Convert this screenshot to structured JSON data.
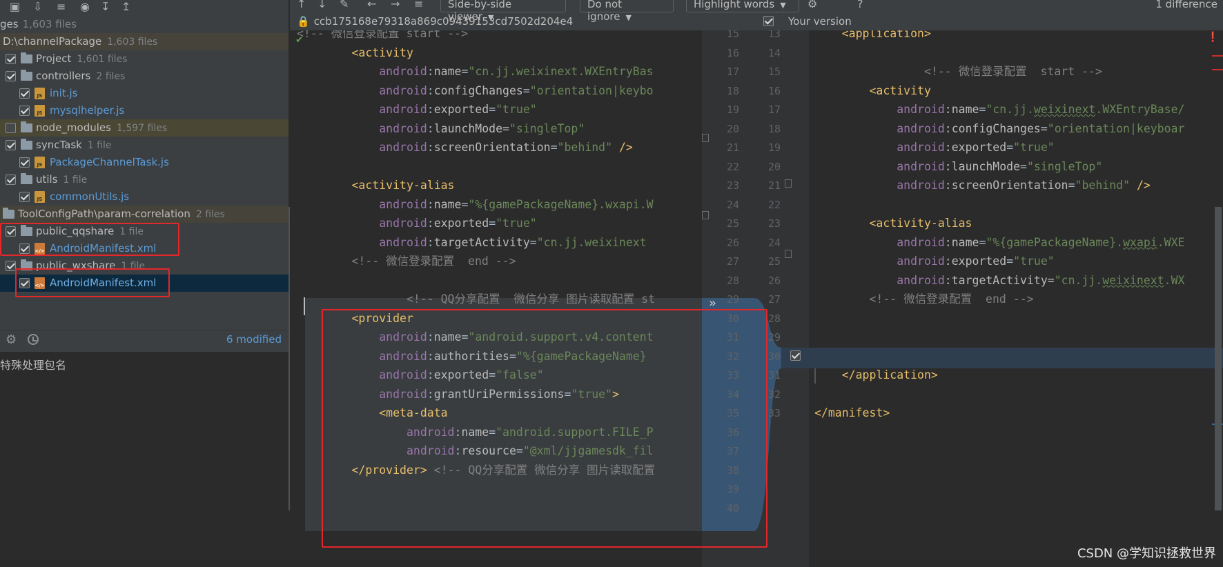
{
  "left_panel": {
    "header": {
      "label": "ges",
      "count": "1,603 files"
    },
    "tree": [
      {
        "label": "D:\\channelPackage",
        "count": "1,603 files",
        "kind": "group-root"
      },
      {
        "label": "Project",
        "count": "1,601 files",
        "kind": "folder"
      },
      {
        "label": "controllers",
        "count": "2 files",
        "kind": "folder"
      },
      {
        "label": "init.js",
        "count": "",
        "kind": "js"
      },
      {
        "label": "mysqlhelper.js",
        "count": "",
        "kind": "js"
      },
      {
        "label": "node_modules",
        "count": "1,597 files",
        "kind": "folder"
      },
      {
        "label": "syncTask",
        "count": "1 file",
        "kind": "folder"
      },
      {
        "label": "PackageChannelTask.js",
        "count": "",
        "kind": "js"
      },
      {
        "label": "utils",
        "count": "1 file",
        "kind": "folder"
      },
      {
        "label": "commonUtils.js",
        "count": "",
        "kind": "js"
      },
      {
        "label": "ToolConfigPath\\param-correlation",
        "count": "2 files",
        "kind": "group-root"
      },
      {
        "label": "public_qqshare",
        "count": "1 file",
        "kind": "folder"
      },
      {
        "label": "AndroidManifest.xml",
        "count": "",
        "kind": "xml"
      },
      {
        "label": "public_wxshare",
        "count": "1 file",
        "kind": "folder"
      },
      {
        "label": "AndroidManifest.xml",
        "count": "",
        "kind": "xml"
      }
    ],
    "status": {
      "modified": "6 modified"
    },
    "commit_message": "特殊处理包名"
  },
  "toolbar": {
    "viewer_mode": "Side-by-side viewer",
    "ignore_mode": "Do not ignore",
    "highlight_mode": "Highlight words",
    "help": "?",
    "diff_count": "1 difference",
    "left_revision": "ccb175168e79318a869c09439153cd7502d204e4",
    "right_label": "Your version"
  },
  "left_editor": {
    "lines": [
      {
        "n": "15",
        "html": "<span class='cmt'>&lt;!-- 微信登录配置 start --&gt;</span>"
      },
      {
        "n": "16",
        "html": "        <span class='tag'>&lt;activity</span>"
      },
      {
        "n": "17",
        "html": "            <span class='attr'>android</span><span class='plain'>:</span><span class='ns'>name</span><span class='plain'>=</span><span class='val'>\"cn.jj.weixinext.WXEntryBas</span>"
      },
      {
        "n": "18",
        "html": "            <span class='attr'>android</span><span class='plain'>:</span><span class='ns'>configChanges</span><span class='plain'>=</span><span class='val'>\"orientation|keybo</span>"
      },
      {
        "n": "19",
        "html": "            <span class='attr'>android</span><span class='plain'>:</span><span class='ns'>exported</span><span class='plain'>=</span><span class='val'>\"true\"</span>"
      },
      {
        "n": "20",
        "html": "            <span class='attr'>android</span><span class='plain'>:</span><span class='ns'>launchMode</span><span class='plain'>=</span><span class='val'>\"singleTop\"</span>"
      },
      {
        "n": "21",
        "html": "            <span class='attr'>android</span><span class='plain'>:</span><span class='ns'>screenOrientation</span><span class='plain'>=</span><span class='val'>\"behind\"</span> <span class='tag'>/&gt;</span>"
      },
      {
        "n": "22",
        "html": ""
      },
      {
        "n": "23",
        "html": "        <span class='tag'>&lt;activity-alias</span>"
      },
      {
        "n": "24",
        "html": "            <span class='attr'>android</span><span class='plain'>:</span><span class='ns'>name</span><span class='plain'>=</span><span class='val'>\"%{gamePackageName}.wxapi.W</span>"
      },
      {
        "n": "25",
        "html": "            <span class='attr'>android</span><span class='plain'>:</span><span class='ns'>exported</span><span class='plain'>=</span><span class='val'>\"true\"</span>"
      },
      {
        "n": "26",
        "html": "            <span class='attr'>android</span><span class='plain'>:</span><span class='ns'>targetActivity</span><span class='plain'>=</span><span class='val'>\"cn.jj.weixinext</span>"
      },
      {
        "n": "27",
        "html": "        <span class='cmt'>&lt;!-- 微信登录配置  end --&gt;</span>"
      },
      {
        "n": "28",
        "html": ""
      },
      {
        "n": "29",
        "html": "                <span class='cmt'>&lt;!-- QQ分享配置  微信分享 图片读取配置 st</span>"
      },
      {
        "n": "30",
        "html": "        <span class='tag'>&lt;provider</span>"
      },
      {
        "n": "31",
        "html": "            <span class='attr'>android</span><span class='plain'>:</span><span class='ns'>name</span><span class='plain'>=</span><span class='val'>\"android.support.v4.content</span>"
      },
      {
        "n": "32",
        "html": "            <span class='attr'>android</span><span class='plain'>:</span><span class='ns'>authorities</span><span class='plain'>=</span><span class='val'>\"%{gamePackageName}</span>"
      },
      {
        "n": "33",
        "html": "            <span class='attr'>android</span><span class='plain'>:</span><span class='ns'>exported</span><span class='plain'>=</span><span class='val'>\"false\"</span>"
      },
      {
        "n": "34",
        "html": "            <span class='attr'>android</span><span class='plain'>:</span><span class='ns'>grantUriPermissions</span><span class='plain'>=</span><span class='val'>\"true\"</span><span class='tag'>&gt;</span>"
      },
      {
        "n": "35",
        "html": "            <span class='tag'>&lt;meta-data</span>"
      },
      {
        "n": "36",
        "html": "                <span class='attr'>android</span><span class='plain'>:</span><span class='ns'>name</span><span class='plain'>=</span><span class='val'>\"android.support.FILE_P</span>"
      },
      {
        "n": "37",
        "html": "                <span class='attr'>android</span><span class='plain'>:</span><span class='ns'>resource</span><span class='plain'>=</span><span class='val'>\"@xml/jjgamesdk_fil</span>"
      },
      {
        "n": "38",
        "html": "        <span class='tag'>&lt;/provider&gt;</span> <span class='cmt'>&lt;!-- QQ分享配置 微信分享 图片读取配置</span>"
      },
      {
        "n": "39",
        "html": ""
      },
      {
        "n": "40",
        "html": ""
      }
    ]
  },
  "right_editor": {
    "lines": [
      {
        "n": "13",
        "html": "    <span class='tag'>&lt;application&gt;</span>"
      },
      {
        "n": "14",
        "html": ""
      },
      {
        "n": "15",
        "html": "                <span class='cmt'>&lt;!-- 微信登录配置  start --&gt;</span>"
      },
      {
        "n": "16",
        "html": "        <span class='tag'>&lt;activity</span>"
      },
      {
        "n": "17",
        "html": "            <span class='attr'>android</span><span class='plain'>:</span><span class='ns'>name</span><span class='plain'>=</span><span class='val'>\"cn.jj.<span class='und'>weixinext</span>.WXEntryBase/</span>"
      },
      {
        "n": "18",
        "html": "            <span class='attr'>android</span><span class='plain'>:</span><span class='ns'>configChanges</span><span class='plain'>=</span><span class='val'>\"orientation|keyboar</span>"
      },
      {
        "n": "19",
        "html": "            <span class='attr'>android</span><span class='plain'>:</span><span class='ns'>exported</span><span class='plain'>=</span><span class='val'>\"true\"</span>"
      },
      {
        "n": "20",
        "html": "            <span class='attr'>android</span><span class='plain'>:</span><span class='ns'>launchMode</span><span class='plain'>=</span><span class='val'>\"singleTop\"</span>"
      },
      {
        "n": "21",
        "html": "            <span class='attr'>android</span><span class='plain'>:</span><span class='ns'>screenOrientation</span><span class='plain'>=</span><span class='val'>\"behind\"</span> <span class='tag'>/&gt;</span>"
      },
      {
        "n": "22",
        "html": ""
      },
      {
        "n": "23",
        "html": "        <span class='tag'>&lt;activity-alias</span>"
      },
      {
        "n": "24",
        "html": "            <span class='attr'>android</span><span class='plain'>:</span><span class='ns'>name</span><span class='plain'>=</span><span class='val'>\"%{gamePackageName}.<span class='und'>wxapi</span>.WXE</span>"
      },
      {
        "n": "25",
        "html": "            <span class='attr'>android</span><span class='plain'>:</span><span class='ns'>exported</span><span class='plain'>=</span><span class='val'>\"true\"</span>"
      },
      {
        "n": "26",
        "html": "            <span class='attr'>android</span><span class='plain'>:</span><span class='ns'>targetActivity</span><span class='plain'>=</span><span class='val'>\"cn.jj.<span class='und'>weixinext</span>.WX</span>"
      },
      {
        "n": "27",
        "html": "        <span class='cmt'>&lt;!-- 微信登录配置  end --&gt;</span>"
      },
      {
        "n": "28",
        "html": ""
      },
      {
        "n": "29",
        "html": ""
      },
      {
        "n": "30",
        "html": ""
      },
      {
        "n": "31",
        "html": "    <span class='tag'>&lt;/application&gt;</span>"
      },
      {
        "n": "32",
        "html": ""
      },
      {
        "n": "33",
        "html": "<span class='tag'>&lt;/manifest&gt;</span>"
      }
    ]
  },
  "watermark": "CSDN @学知识拯救世界",
  "colors": {
    "highlight_red": "#e5262b",
    "diff_blue": "#385573",
    "selection": "#0d293e"
  }
}
